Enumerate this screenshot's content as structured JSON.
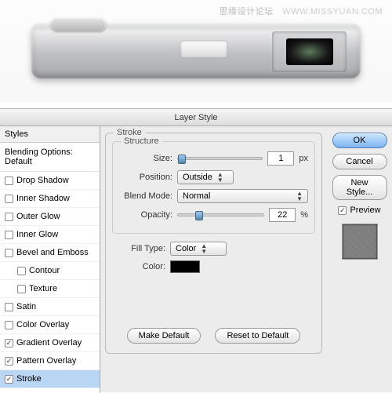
{
  "watermark": {
    "cn": "思缘设计论坛",
    "url": "WWW.MISSYUAN.COM"
  },
  "dialog": {
    "title": "Layer Style"
  },
  "sidebar": {
    "header": "Styles",
    "blending": "Blending Options: Default",
    "items": [
      {
        "label": "Drop Shadow",
        "checked": false
      },
      {
        "label": "Inner Shadow",
        "checked": false
      },
      {
        "label": "Outer Glow",
        "checked": false
      },
      {
        "label": "Inner Glow",
        "checked": false
      },
      {
        "label": "Bevel and Emboss",
        "checked": false
      },
      {
        "label": "Contour",
        "checked": false,
        "indent": true
      },
      {
        "label": "Texture",
        "checked": false,
        "indent": true
      },
      {
        "label": "Satin",
        "checked": false
      },
      {
        "label": "Color Overlay",
        "checked": false
      },
      {
        "label": "Gradient Overlay",
        "checked": true
      },
      {
        "label": "Pattern Overlay",
        "checked": true
      },
      {
        "label": "Stroke",
        "checked": true,
        "selected": true
      }
    ]
  },
  "stroke": {
    "legend": "Stroke",
    "structure_legend": "Structure",
    "size_label": "Size:",
    "size_value": "1",
    "size_unit": "px",
    "position_label": "Position:",
    "position_value": "Outside",
    "blend_label": "Blend Mode:",
    "blend_value": "Normal",
    "opacity_label": "Opacity:",
    "opacity_value": "22",
    "opacity_unit": "%",
    "filltype_label": "Fill Type:",
    "filltype_value": "Color",
    "color_label": "Color:"
  },
  "buttons": {
    "make_default": "Make Default",
    "reset_default": "Reset to Default",
    "ok": "OK",
    "cancel": "Cancel",
    "new_style": "New Style...",
    "preview": "Preview"
  }
}
